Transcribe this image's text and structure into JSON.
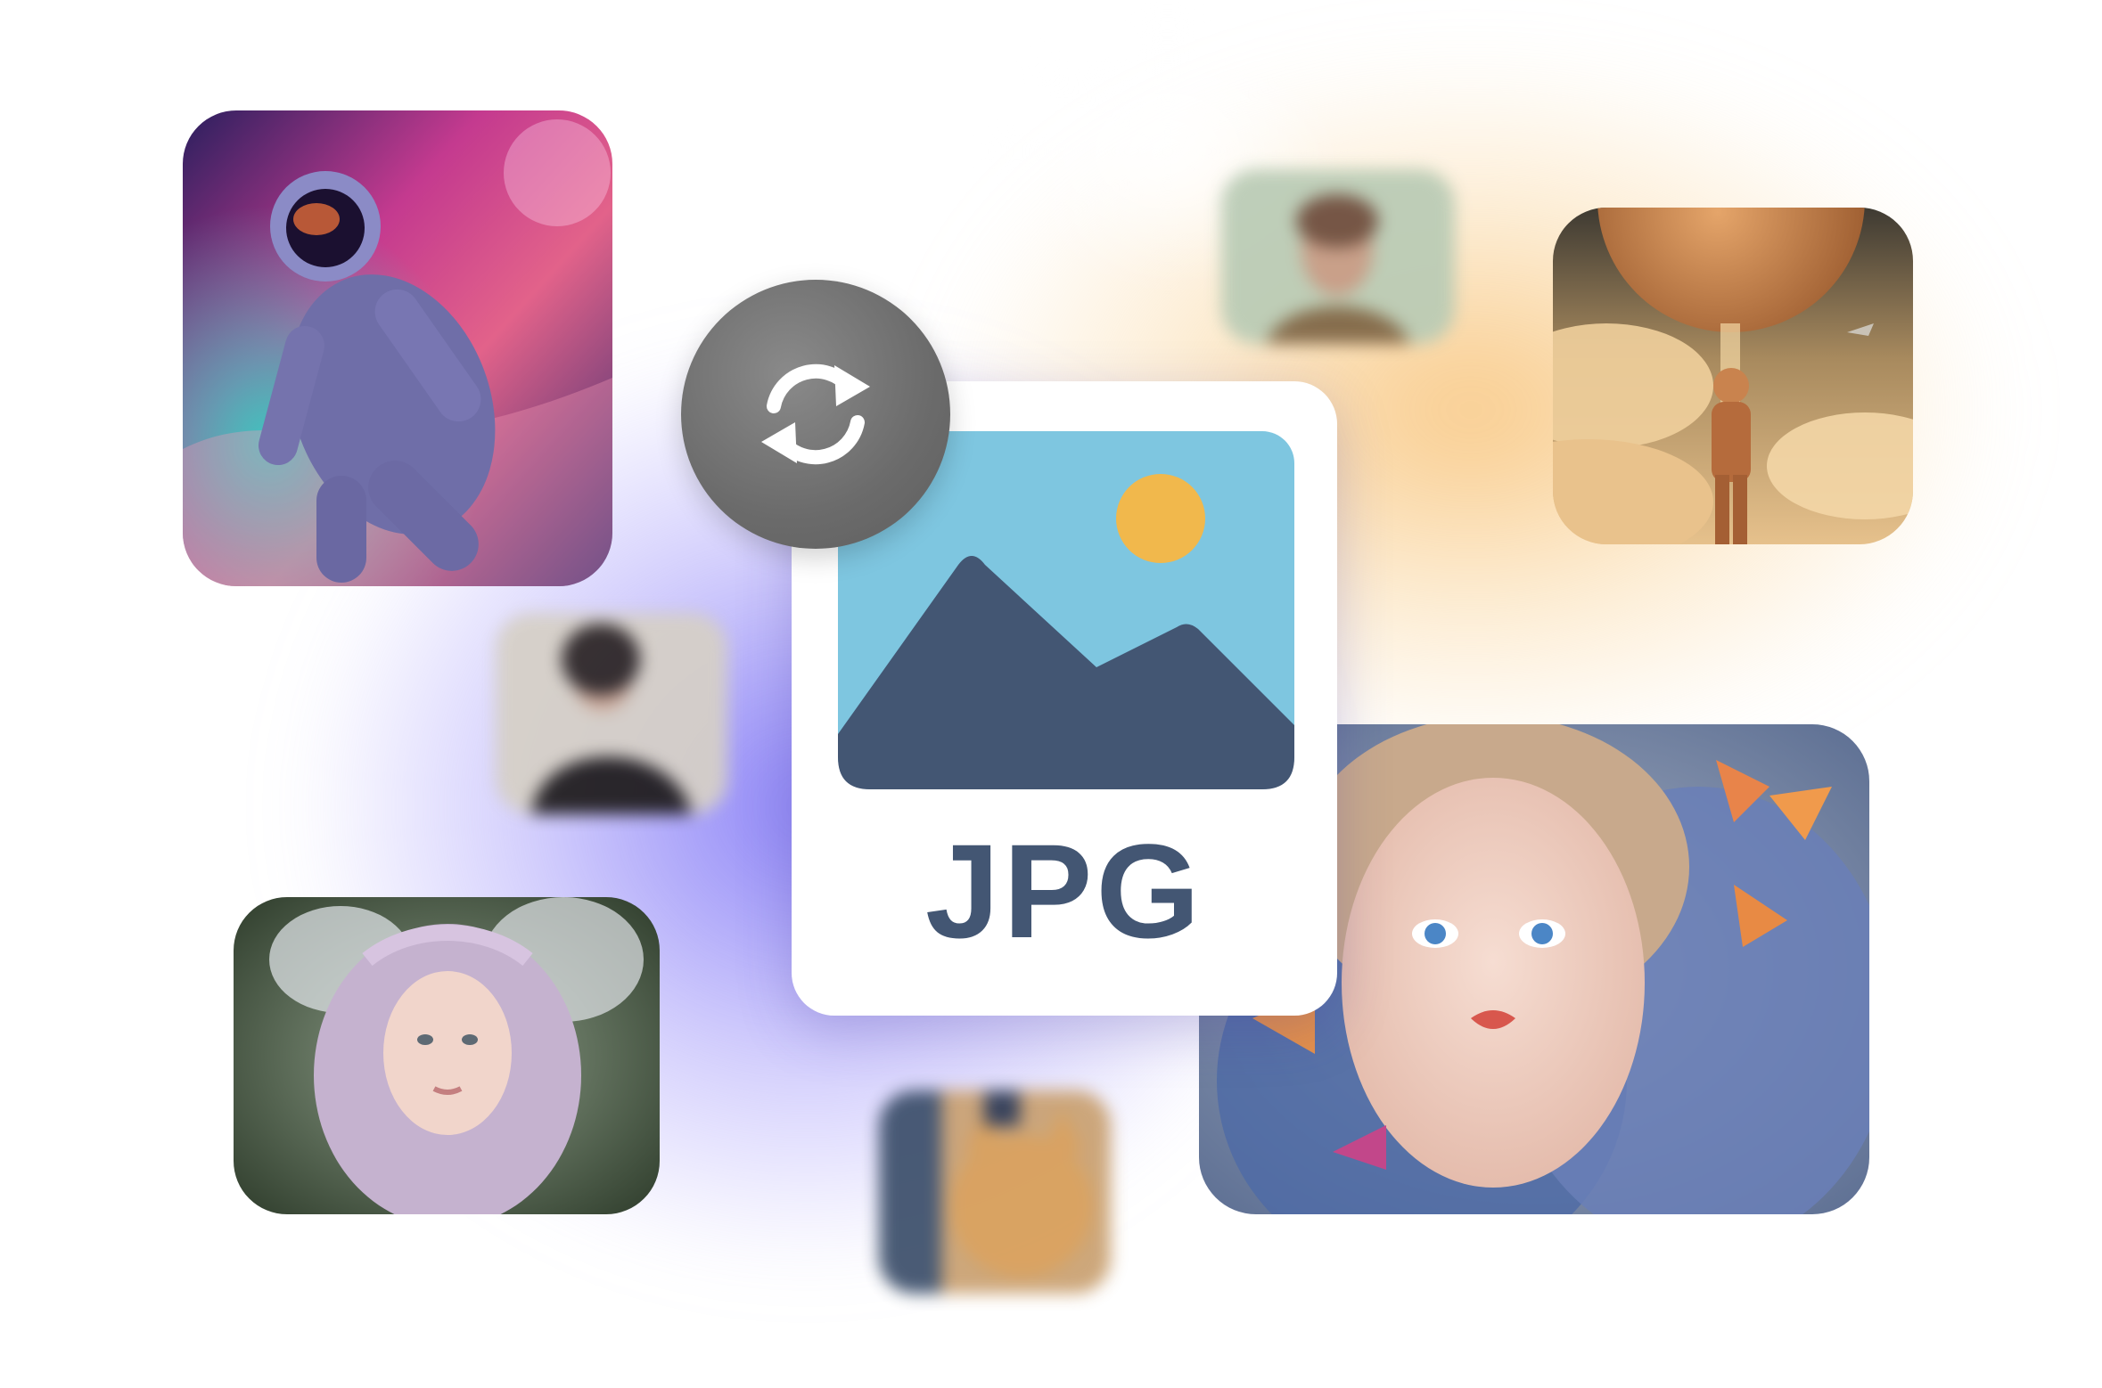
{
  "file_card": {
    "label": "JPG",
    "icon": "image-icon"
  },
  "convert_badge": {
    "icon": "refresh-icon"
  },
  "colors": {
    "file_label": "#435673",
    "sky": "#7ec6e0",
    "mountain": "#435673",
    "sun": "#f1b84c",
    "badge": "#6f6f6f",
    "glow_purple": "#786ef5",
    "glow_orange": "#f7be6e"
  },
  "gallery": [
    {
      "name": "astronaut-artwork"
    },
    {
      "name": "portrait-blurred-top"
    },
    {
      "name": "astronaut-planet-artwork"
    },
    {
      "name": "woman-blurred"
    },
    {
      "name": "fairy-portrait"
    },
    {
      "name": "cat-blurred"
    },
    {
      "name": "butterfly-portrait"
    }
  ]
}
